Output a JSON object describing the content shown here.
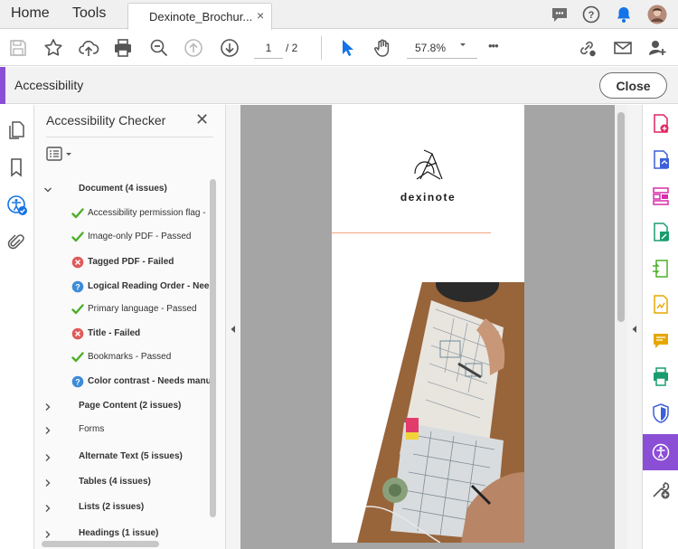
{
  "tabbar": {
    "home": "Home",
    "tools": "Tools",
    "doc_tab_title": "Dexinote_Brochur...",
    "close_tab": "×"
  },
  "toolbar": {
    "page_current": "1",
    "page_total": "/ 2",
    "zoom": "57.8%",
    "more": "•••"
  },
  "accessibility": {
    "title": "Accessibility",
    "close_label": "Close"
  },
  "checker": {
    "title": "Accessibility Checker",
    "close": "✕",
    "document_group": "Document (4 issues)",
    "items": [
      {
        "label": "Accessibility permission flag - ",
        "status": "pass",
        "bold": false
      },
      {
        "label": "Image-only PDF - Passed",
        "status": "pass",
        "bold": false
      },
      {
        "label": "Tagged PDF - Failed",
        "status": "fail",
        "bold": true
      },
      {
        "label": "Logical Reading Order - Need",
        "status": "manual",
        "bold": true
      },
      {
        "label": "Primary language - Passed",
        "status": "pass",
        "bold": false
      },
      {
        "label": "Title - Failed",
        "status": "fail",
        "bold": true
      },
      {
        "label": "Bookmarks - Passed",
        "status": "pass",
        "bold": false
      },
      {
        "label": "Color contrast - Needs manu",
        "status": "manual",
        "bold": true
      }
    ],
    "groups": [
      {
        "label": "Page Content (2 issues)",
        "bold": true
      },
      {
        "label": "Forms",
        "bold": false
      },
      {
        "label": "Alternate Text (5 issues)",
        "bold": true
      },
      {
        "label": "Tables (4 issues)",
        "bold": true
      },
      {
        "label": "Lists (2 issues)",
        "bold": true
      },
      {
        "label": "Headings (1 issue)",
        "bold": true
      }
    ]
  },
  "document": {
    "brand": "dexinote"
  },
  "colors": {
    "accent": "#8b4fd6",
    "pass": "#4caf28",
    "fail": "#e05a5a",
    "manual": "#3d8bd9",
    "orange_line": "#f3a57c"
  },
  "icons": {
    "tabbar": [
      "chat-icon",
      "help-icon",
      "bell-icon",
      "avatar"
    ],
    "toolbar": [
      "save-icon",
      "star-icon",
      "upload-cloud-icon",
      "print-icon",
      "zoom-out-icon",
      "page-up-icon",
      "page-down-icon",
      "select-cursor-icon",
      "hand-icon",
      "chevron-down-icon",
      "more-icon",
      "link-share-icon",
      "mail-icon",
      "add-user-icon"
    ],
    "left_nav": [
      "page-thumbnails-icon",
      "bookmark-icon",
      "accessibility-icon",
      "attachment-icon"
    ],
    "right_rail": [
      "create-pdf-icon",
      "export-pdf-icon",
      "organize-pages-icon",
      "edit-pdf-icon",
      "compress-pdf-icon",
      "fill-sign-icon",
      "comment-icon",
      "print-production-icon",
      "protect-icon",
      "accessibility-tool-icon",
      "more-tools-icon"
    ]
  }
}
